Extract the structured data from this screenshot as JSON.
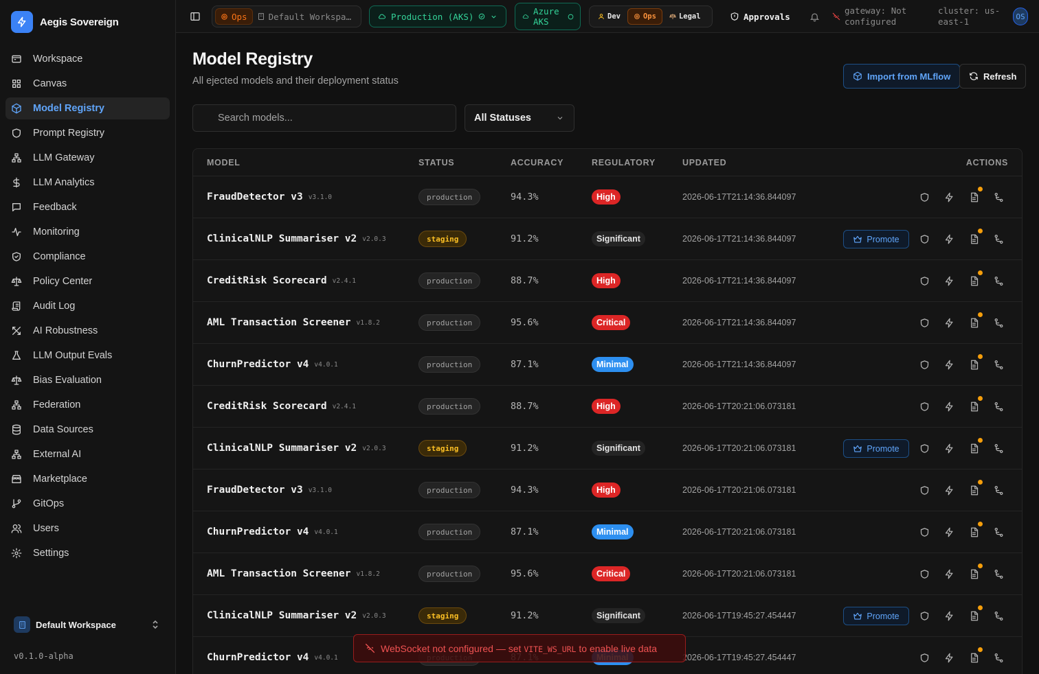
{
  "app": {
    "name": "Aegis Sovereign",
    "version": "v0.1.0-alpha",
    "workspace": "Default Workspace"
  },
  "sidebar": {
    "items": [
      {
        "label": "Workspace",
        "icon": "workspace-icon",
        "active": false
      },
      {
        "label": "Canvas",
        "icon": "grid-icon",
        "active": false
      },
      {
        "label": "Model Registry",
        "icon": "cube-icon",
        "active": true
      },
      {
        "label": "Prompt Registry",
        "icon": "shield-icon",
        "active": false
      },
      {
        "label": "LLM Gateway",
        "icon": "network-icon",
        "active": false
      },
      {
        "label": "LLM Analytics",
        "icon": "dollar-icon",
        "active": false
      },
      {
        "label": "Feedback",
        "icon": "message-icon",
        "active": false
      },
      {
        "label": "Monitoring",
        "icon": "activity-icon",
        "active": false
      },
      {
        "label": "Compliance",
        "icon": "shield-check-icon",
        "active": false
      },
      {
        "label": "Policy Center",
        "icon": "scale-icon",
        "active": false
      },
      {
        "label": "Audit Log",
        "icon": "scroll-icon",
        "active": false
      },
      {
        "label": "AI Robustness",
        "icon": "swords-icon",
        "active": false
      },
      {
        "label": "LLM Output Evals",
        "icon": "flask-icon",
        "active": false
      },
      {
        "label": "Bias Evaluation",
        "icon": "scale-icon",
        "active": false
      },
      {
        "label": "Federation",
        "icon": "network-icon",
        "active": false
      },
      {
        "label": "Data Sources",
        "icon": "database-icon",
        "active": false
      },
      {
        "label": "External AI",
        "icon": "network-icon",
        "active": false
      },
      {
        "label": "Marketplace",
        "icon": "store-icon",
        "active": false
      },
      {
        "label": "GitOps",
        "icon": "git-branch-icon",
        "active": false
      },
      {
        "label": "Users",
        "icon": "users-icon",
        "active": false
      },
      {
        "label": "Settings",
        "icon": "gear-icon",
        "active": false
      }
    ]
  },
  "topbar": {
    "ops_label": "Ops",
    "workspace_label": "Default Workspa…",
    "env_label": "Production (AKS)",
    "cloud_label_line1": "Azure",
    "cloud_label_line2": "AKS",
    "roles": [
      "Dev",
      "Ops",
      "Legal"
    ],
    "approvals_label": "Approvals",
    "gateway_line1": "gateway: Not",
    "gateway_line2": "configured",
    "cluster_line1": "cluster: us-",
    "cluster_line2": "east-1",
    "avatar_initials": "OS"
  },
  "main": {
    "title": "Model Registry",
    "subtitle": "All ejected models and their deployment status",
    "import_label": "Import from MLflow",
    "refresh_label": "Refresh",
    "search_placeholder": "Search models...",
    "status_filter": "All Statuses",
    "promote_label": "Promote"
  },
  "table": {
    "columns": [
      "MODEL",
      "STATUS",
      "ACCURACY",
      "REGULATORY",
      "UPDATED",
      "ACTIONS"
    ],
    "rows": [
      {
        "name": "FraudDetector v3",
        "version": "v3.1.0",
        "status": "production",
        "accuracy": "94.3%",
        "regulatory": "High",
        "updated": "2026-06-17T21:14:36.844097"
      },
      {
        "name": "ClinicalNLP Summariser v2",
        "version": "v2.0.3",
        "status": "staging",
        "accuracy": "91.2%",
        "regulatory": "Significant",
        "updated": "2026-06-17T21:14:36.844097"
      },
      {
        "name": "CreditRisk Scorecard",
        "version": "v2.4.1",
        "status": "production",
        "accuracy": "88.7%",
        "regulatory": "High",
        "updated": "2026-06-17T21:14:36.844097"
      },
      {
        "name": "AML Transaction Screener",
        "version": "v1.8.2",
        "status": "production",
        "accuracy": "95.6%",
        "regulatory": "Critical",
        "updated": "2026-06-17T21:14:36.844097"
      },
      {
        "name": "ChurnPredictor v4",
        "version": "v4.0.1",
        "status": "production",
        "accuracy": "87.1%",
        "regulatory": "Minimal",
        "updated": "2026-06-17T21:14:36.844097"
      },
      {
        "name": "CreditRisk Scorecard",
        "version": "v2.4.1",
        "status": "production",
        "accuracy": "88.7%",
        "regulatory": "High",
        "updated": "2026-06-17T20:21:06.073181"
      },
      {
        "name": "ClinicalNLP Summariser v2",
        "version": "v2.0.3",
        "status": "staging",
        "accuracy": "91.2%",
        "regulatory": "Significant",
        "updated": "2026-06-17T20:21:06.073181"
      },
      {
        "name": "FraudDetector v3",
        "version": "v3.1.0",
        "status": "production",
        "accuracy": "94.3%",
        "regulatory": "High",
        "updated": "2026-06-17T20:21:06.073181"
      },
      {
        "name": "ChurnPredictor v4",
        "version": "v4.0.1",
        "status": "production",
        "accuracy": "87.1%",
        "regulatory": "Minimal",
        "updated": "2026-06-17T20:21:06.073181"
      },
      {
        "name": "AML Transaction Screener",
        "version": "v1.8.2",
        "status": "production",
        "accuracy": "95.6%",
        "regulatory": "Critical",
        "updated": "2026-06-17T20:21:06.073181"
      },
      {
        "name": "ClinicalNLP Summariser v2",
        "version": "v2.0.3",
        "status": "staging",
        "accuracy": "91.2%",
        "regulatory": "Significant",
        "updated": "2026-06-17T19:45:27.454447"
      },
      {
        "name": "ChurnPredictor v4",
        "version": "v4.0.1",
        "status": "production",
        "accuracy": "87.1%",
        "regulatory": "Minimal",
        "updated": "2026-06-17T19:45:27.454447"
      }
    ]
  },
  "toast": {
    "text_before": "WebSocket not configured — set ",
    "code": "VITE_WS_URL",
    "text_after": " to enable live data"
  },
  "colors": {
    "accent": "#3b82f6",
    "high": "#dc2626",
    "minimal": "#2d8ff0",
    "staging": "#fbbf24",
    "notify_dot": "#f59e0b"
  }
}
